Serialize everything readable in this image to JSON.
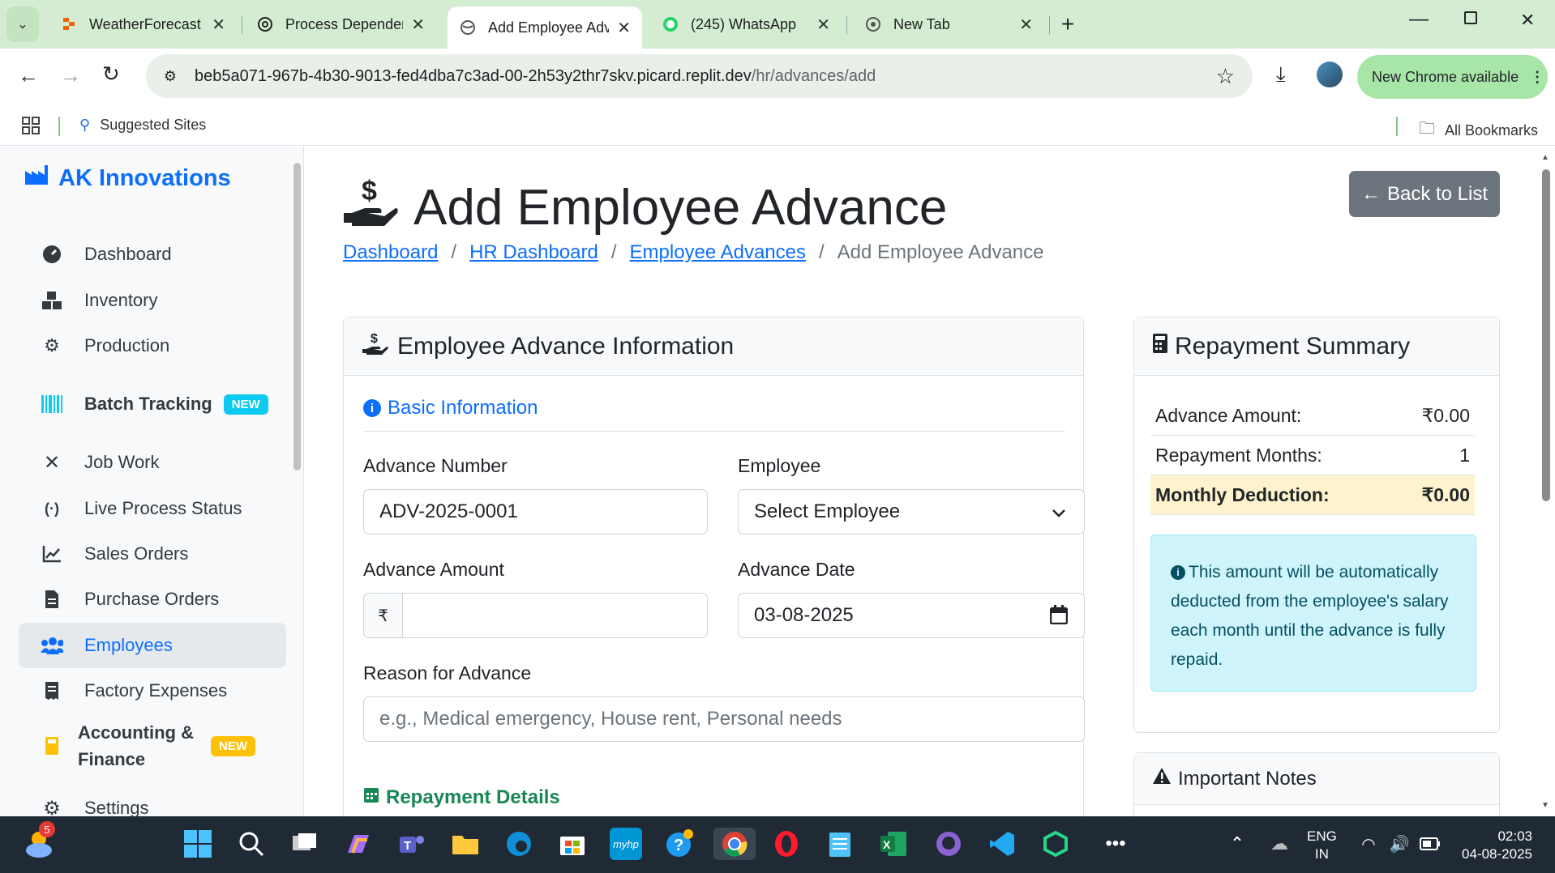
{
  "browser": {
    "tabs": [
      {
        "title": "WeatherForecast - Replit"
      },
      {
        "title": "Process Dependencies O"
      },
      {
        "title": "Add Employee Advance -"
      },
      {
        "title": "(245) WhatsApp"
      },
      {
        "title": "New Tab"
      }
    ],
    "url_host": "beb5a071-967b-4b30-9013-fed4dba7c3ad-00-2h53y2thr7skv.picard.replit.dev",
    "url_path": "/hr/advances/add",
    "update_label": "New Chrome available",
    "bookmarks_left": "Suggested Sites",
    "bookmarks_right": "All Bookmarks"
  },
  "sidebar": {
    "brand": "AK Innovations",
    "items": [
      {
        "label": "Dashboard"
      },
      {
        "label": "Inventory"
      },
      {
        "label": "Production"
      },
      {
        "label": "Batch Tracking",
        "badge": "NEW"
      },
      {
        "label": "Job Work"
      },
      {
        "label": "Live Process Status"
      },
      {
        "label": "Sales Orders"
      },
      {
        "label": "Purchase Orders"
      },
      {
        "label": "Employees"
      },
      {
        "label": "Factory Expenses"
      },
      {
        "label": "Accounting &",
        "label2": "Finance",
        "badge": "NEW"
      },
      {
        "label": "Settings"
      }
    ]
  },
  "page": {
    "title": "Add Employee Advance",
    "back_label": "Back to List",
    "breadcrumb": [
      "Dashboard",
      "HR Dashboard",
      "Employee Advances",
      "Add Employee Advance"
    ]
  },
  "form": {
    "card_title": "Employee Advance Information",
    "basic_title": "Basic Information",
    "advance_number_label": "Advance Number",
    "advance_number_value": "ADV-2025-0001",
    "employee_label": "Employee",
    "employee_value": "Select Employee",
    "amount_label": "Advance Amount",
    "currency_symbol": "₹",
    "date_label": "Advance Date",
    "date_value": "03-08-2025",
    "reason_label": "Reason for Advance",
    "reason_placeholder": "e.g., Medical emergency, House rent, Personal needs",
    "repayment_title": "Repayment Details"
  },
  "summary": {
    "title": "Repayment Summary",
    "rows": [
      {
        "label": "Advance Amount:",
        "value": "₹0.00"
      },
      {
        "label": "Repayment Months:",
        "value": "1"
      },
      {
        "label": "Monthly Deduction:",
        "value": "₹0.00"
      }
    ],
    "info_text": "This amount will be automatically deducted from the employee's salary each month until the advance is fully repaid.",
    "notes_title": "Important Notes"
  },
  "taskbar": {
    "weather_badge": "5",
    "lang": "ENG",
    "region": "IN",
    "time": "02:03",
    "date": "04-08-2025"
  },
  "colors": {
    "primary": "#0d6efd",
    "success": "#198754",
    "warning_row": "#fff3cd",
    "info_bg": "#cff4fc"
  }
}
